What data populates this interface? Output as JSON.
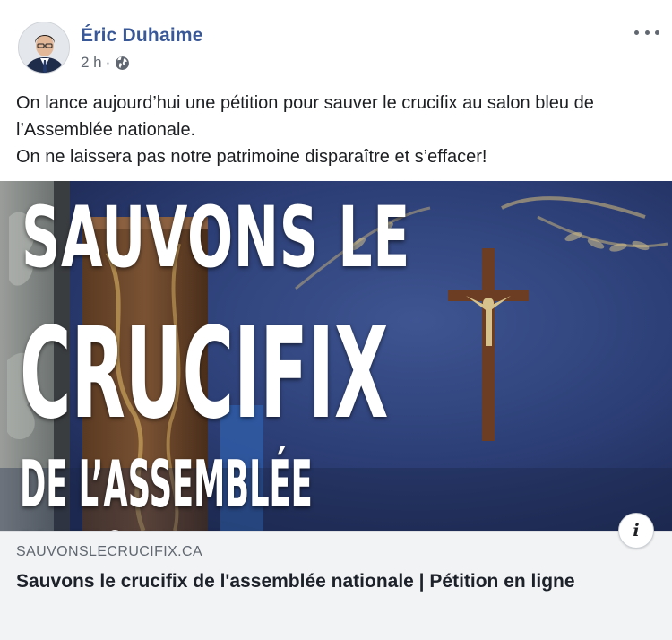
{
  "post": {
    "author": "Éric Duhaime",
    "time": "2 h",
    "separator": "·",
    "audience_icon": "globe-icon",
    "menu_icon": "more-options-icon",
    "text_lines": [
      "On lance aujourd’hui une pétition pour sauver le crucifix au salon bleu de l’Assemblée nationale.",
      "On ne laissera pas notre patrimoine disparaître et s’effacer!"
    ]
  },
  "image": {
    "headline_line1": "SAUVONS LE",
    "headline_line2": "CRUCIFIX",
    "headline_line3": "DE L’ASSEMBLÉE NATIONALE",
    "info_label": "i"
  },
  "link": {
    "domain": "SAUVONSLECRUCIFIX.CA",
    "title": "Sauvons le crucifix de l'assemblée nationale | Pétition en ligne"
  },
  "colors": {
    "author": "#385898",
    "meta": "#606770",
    "card_bg": "#f2f3f5",
    "hero_blue": "#2a3a6b"
  }
}
